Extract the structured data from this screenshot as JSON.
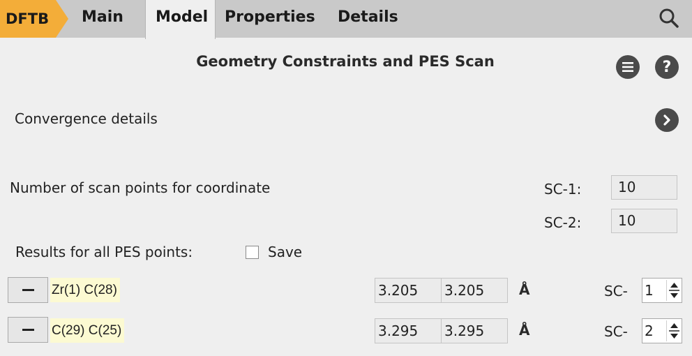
{
  "tabs": {
    "dftb": "DFTB",
    "main": "Main",
    "model": "Model",
    "properties": "Properties",
    "details": "Details"
  },
  "panel": {
    "title": "Geometry Constraints and PES Scan",
    "convergence_label": "Convergence details",
    "scan_points_label": "Number of scan points for coordinate",
    "sc1_label": "SC-1:",
    "sc1_value": "10",
    "sc2_label": "SC-2:",
    "sc2_value": "10",
    "results_label": "Results for all PES points:",
    "save_label": "Save",
    "save_checked": false
  },
  "constraints": [
    {
      "atoms": "Zr(1) C(28)",
      "start": "3.205",
      "end": "3.205",
      "unit": "Å",
      "sc_prefix": "SC-",
      "sc_index": "1"
    },
    {
      "atoms": "C(29) C(25)",
      "start": "3.295",
      "end": "3.295",
      "unit": "Å",
      "sc_prefix": "SC-",
      "sc_index": "2"
    }
  ],
  "icons": {
    "search": "search-icon",
    "menu": "menu-icon",
    "help": "help-icon",
    "expand": "chevron-right-icon",
    "remove": "minus-icon",
    "spinner": "spinner-arrows-icon"
  },
  "colors": {
    "accent_tab": "#f3ad39",
    "tabbar": "#c9c9c9",
    "panel_bg": "#efefef",
    "atoms_highlight": "#fcfad2",
    "circle_button": "#4a4a4a"
  }
}
